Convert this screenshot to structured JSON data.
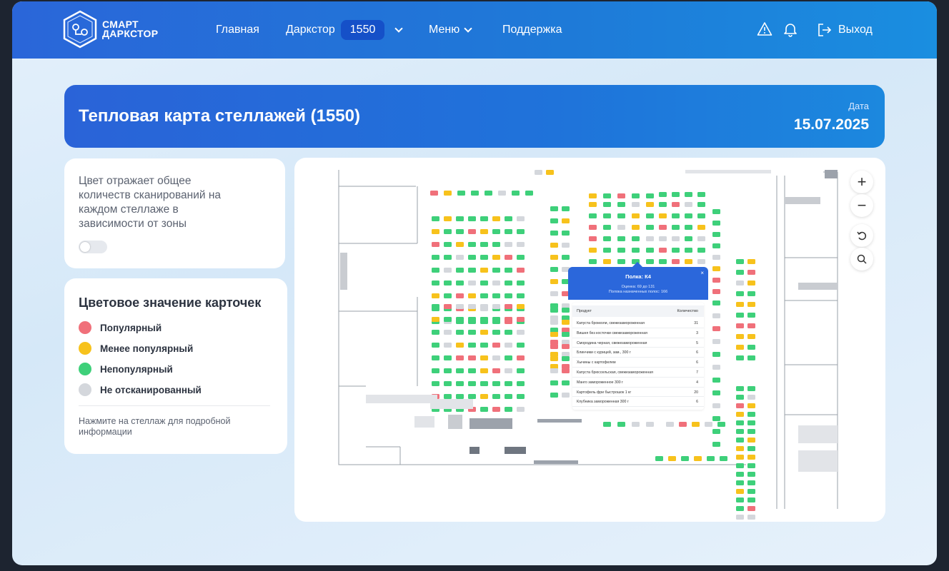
{
  "brand": {
    "line1": "СМАРТ",
    "line2": "ДАРКСТОР"
  },
  "nav": {
    "home": "Главная",
    "darkstore": "Даркстор",
    "darkstore_id": "1550",
    "menu": "Меню",
    "support": "Поддержка",
    "exit": "Выход"
  },
  "header": {
    "title": "Тепловая карта стеллажей (1550)",
    "date_label": "Дата",
    "date_value": "15.07.2025"
  },
  "info": {
    "text": "Цвет отражает общее количеств сканирований на каждом стеллаже в зависимости от зоны"
  },
  "legend": {
    "title": "Цветовое значение карточек",
    "items": [
      {
        "label": "Популярный",
        "color": "#f0707a"
      },
      {
        "label": "Менее популярный",
        "color": "#f7c21c"
      },
      {
        "label": "Непопулярный",
        "color": "#3ed07a"
      },
      {
        "label": "Не отсканированный",
        "color": "#d4d7dc"
      }
    ],
    "hint": "Нажмите на стеллаж для подробной информации"
  },
  "map_controls": {
    "zoom_in": "+",
    "zoom_out": "−"
  },
  "popup": {
    "title": "Полка: К4",
    "line1": "Оценка: 69 до 131",
    "line2": "Полока назначенных полос: 166",
    "close": "×",
    "col_product": "Продукт",
    "col_qty": "Количество",
    "rows": [
      {
        "name": "Капуста брокколи, свежезамороженная",
        "qty": "31"
      },
      {
        "name": "Вишня без косточки свежезамороженная",
        "qty": "3"
      },
      {
        "name": "Смородина черная, свежезамороженная",
        "qty": "5"
      },
      {
        "name": "Блинчики с курицей, зам., 300 г",
        "qty": "6"
      },
      {
        "name": "Хычины с картофелем",
        "qty": "6"
      },
      {
        "name": "Капуста брюссельская, свежезамороженная",
        "qty": "7"
      },
      {
        "name": "Манго замороженное 300 г",
        "qty": "4"
      },
      {
        "name": "Картофель фри быстрошок 1 кг",
        "qty": "20"
      },
      {
        "name": "Клубника замороженная 300 г",
        "qty": "6"
      }
    ]
  },
  "heatmap_colors": {
    "popular": "#f0707a",
    "less_popular": "#f7c21c",
    "unpopular": "#3ed07a",
    "not_scanned": "#d4d7dc"
  }
}
